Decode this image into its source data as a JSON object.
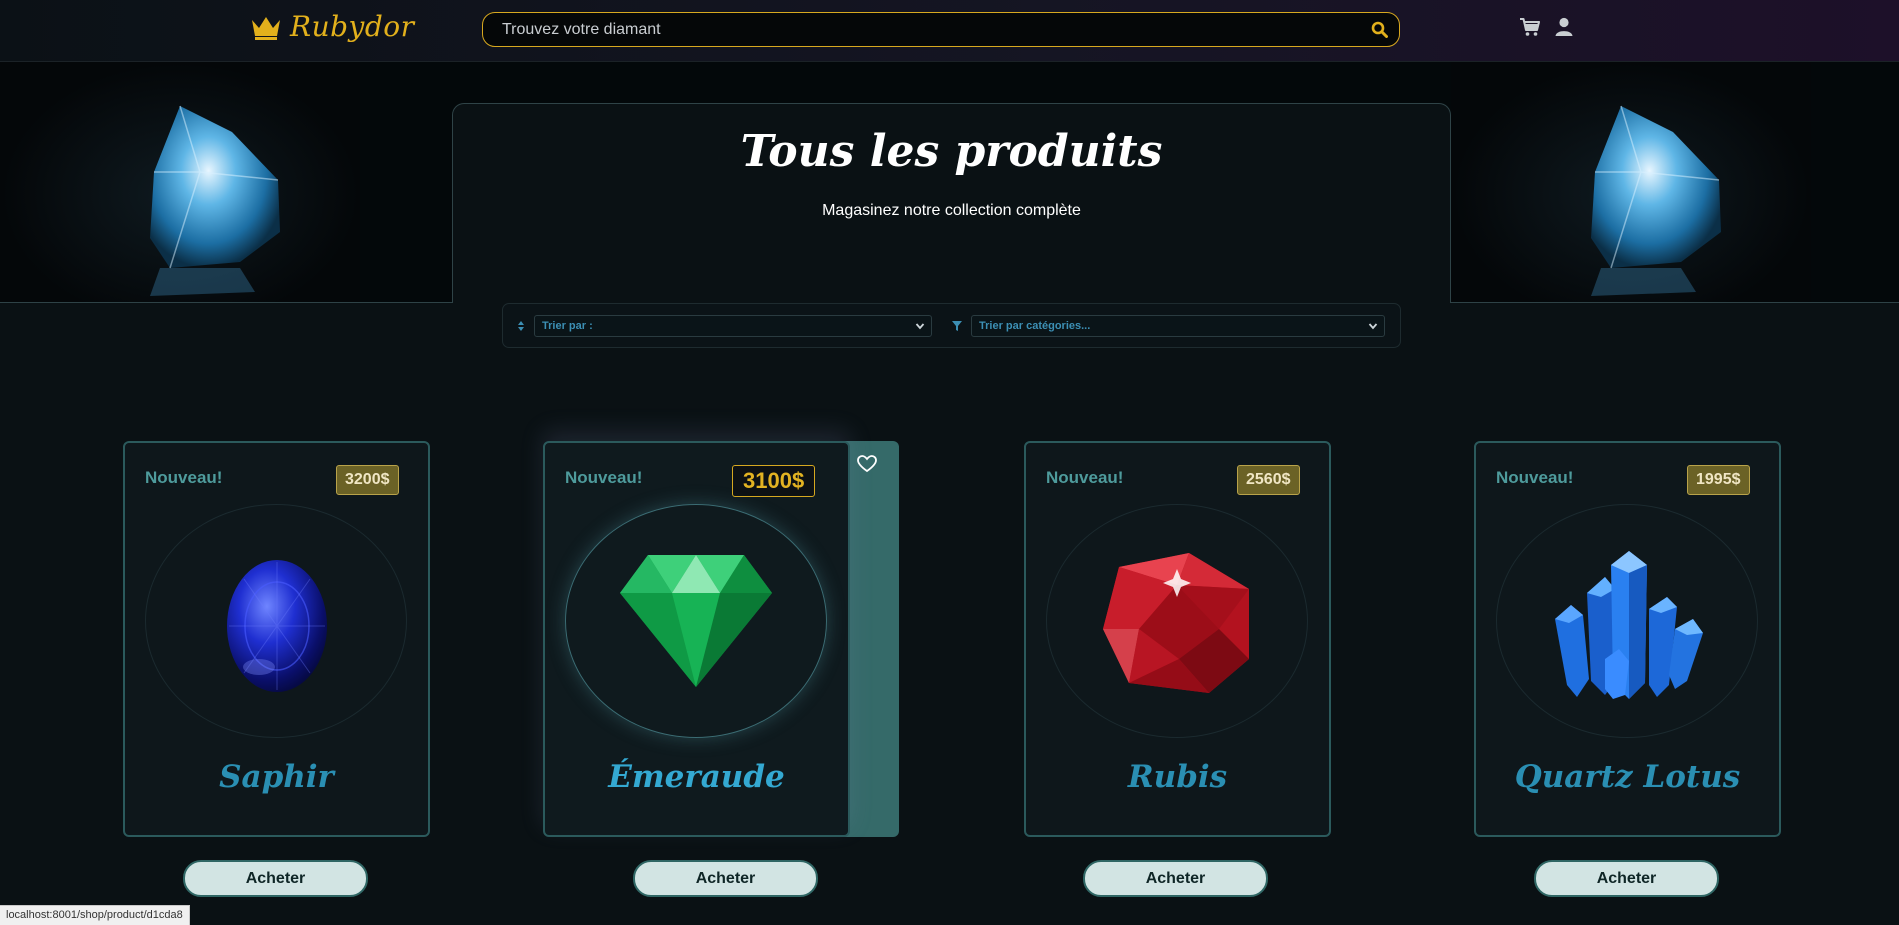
{
  "header": {
    "brand": "Rubydor",
    "search_placeholder": "Trouvez votre diamant",
    "icons": [
      "crown-icon",
      "search-icon",
      "cart-icon",
      "user-icon"
    ]
  },
  "hero": {
    "title": "Tous les produits",
    "subtitle": "Magasinez notre collection complète"
  },
  "filters": {
    "sort_label": "Trier par :",
    "category_label": "Trier par catégories..."
  },
  "products": [
    {
      "badge": "Nouveau!",
      "price": "3200$",
      "name": "Saphir",
      "gem": "sapphire",
      "buy": "Acheter"
    },
    {
      "badge": "Nouveau!",
      "price": "3100$",
      "name": "Émeraude",
      "gem": "emerald",
      "buy": "Acheter"
    },
    {
      "badge": "Nouveau!",
      "price": "2560$",
      "name": "Rubis",
      "gem": "ruby",
      "buy": "Acheter"
    },
    {
      "badge": "Nouveau!",
      "price": "1995$",
      "name": "Quartz Lotus",
      "gem": "quartz-crystal",
      "buy": "Acheter"
    }
  ],
  "status_bar": {
    "url": "localhost:8001/shop/product/d1cda8"
  },
  "colors": {
    "gold": "#e2b01c",
    "teal": "#2b5a5c",
    "product_name": "#2a8fb3",
    "background": "#0a1114"
  }
}
